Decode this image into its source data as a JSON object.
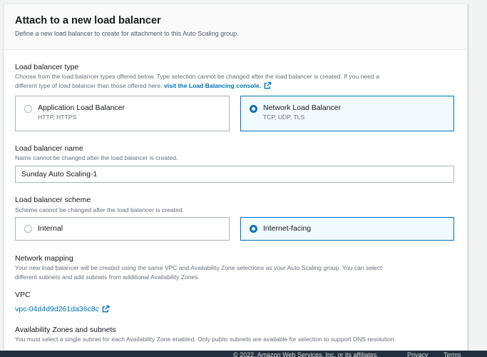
{
  "header": {
    "title": "Attach to a new load balancer",
    "description": "Define a new load balancer to create for attachment to this Auto Scaling group."
  },
  "lb_type": {
    "label": "Load balancer type",
    "description_line1": "Choose from the load balancer types offered below. Type selection cannot be changed after the load balancer is created. If you need a",
    "description_line2": "different type of load balancer than those offered here,",
    "console_link": "visit the Load Balancing console.",
    "options": [
      {
        "title": "Application Load Balancer",
        "subtitle": "HTTP, HTTPS",
        "selected": false
      },
      {
        "title": "Network Load Balancer",
        "subtitle": "TCP, UDP, TLS",
        "selected": true
      }
    ]
  },
  "lb_name": {
    "label": "Load balancer name",
    "description": "Name cannot be changed after the load balancer is created.",
    "value": "Sunday Auto Scaling-1"
  },
  "lb_scheme": {
    "label": "Load balancer scheme",
    "description": "Scheme cannot be changed after the load balancer is created.",
    "options": [
      {
        "title": "Internal",
        "selected": false
      },
      {
        "title": "Internet-facing",
        "selected": true
      }
    ]
  },
  "network_mapping": {
    "label": "Network mapping",
    "description_line1": "Your new load balancer will be created using the same VPC and Availability Zone selections as your Auto Scaling group. You can select",
    "description_line2": "different subnets and add subnets from additional Availability Zones."
  },
  "vpc": {
    "label": "VPC",
    "value": "vpc-04d4d9d261da36c8c"
  },
  "az": {
    "label": "Availability Zones and subnets",
    "description": "You must select a single subnet for each Availability Zone enabled. Only public subnets are available for selection to support DNS resolution."
  },
  "footer": {
    "copyright": "© 2022, Amazon Web Services, Inc. or its affiliates.",
    "privacy": "Privacy",
    "terms": "Terms"
  },
  "colors": {
    "link": "#0073bb",
    "selected_border": "#0073bb",
    "selected_bg": "#f1faff"
  },
  "icons": [
    "external-link-icon",
    "radio-button-icon"
  ]
}
